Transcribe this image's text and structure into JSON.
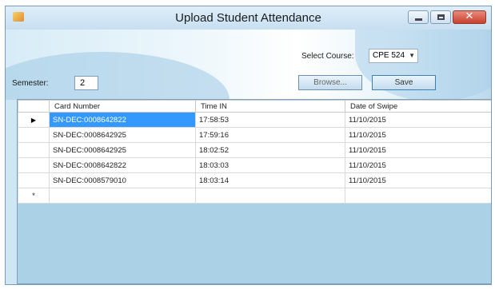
{
  "window": {
    "title": "Upload Student Attendance",
    "controls": [
      "minimize",
      "maximize",
      "close"
    ]
  },
  "form": {
    "course_label": "Select Course:",
    "course_value": "CPE 524",
    "semester_label": "Semester:",
    "semester_value": "2",
    "browse_label": "Browse...",
    "save_label": "Save"
  },
  "grid": {
    "columns": [
      "Card Number",
      "Time IN",
      "Date of Swipe"
    ],
    "rows": [
      {
        "card": "SN-DEC:0008642822",
        "time": "17:58:53",
        "date": "11/10/2015"
      },
      {
        "card": "SN-DEC:0008642925",
        "time": "17:59:16",
        "date": "11/10/2015"
      },
      {
        "card": "SN-DEC:0008642925",
        "time": "18:02:52",
        "date": "11/10/2015"
      },
      {
        "card": "SN-DEC:0008642822",
        "time": "18:03:03",
        "date": "11/10/2015"
      },
      {
        "card": "SN-DEC:0008579010",
        "time": "18:03:14",
        "date": "11/10/2015"
      }
    ],
    "current_row_marker": "▶",
    "new_row_marker": "*"
  },
  "colors": {
    "selection": "#3399ff",
    "panel": "#abd1e7"
  }
}
